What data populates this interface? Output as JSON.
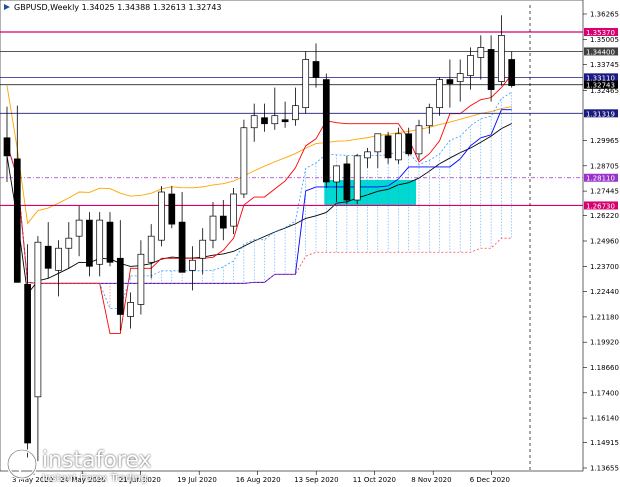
{
  "chart_title": "GBPUSD,Weekly  1.34025 1.34388 1.32613 1.32743",
  "chart_data": {
    "type": "candlestick",
    "title": "GBPUSD,Weekly  1.34025 1.34388 1.32613 1.32743",
    "symbol": "GBPUSD",
    "timeframe": "Weekly",
    "ohlc_readout": {
      "open": 1.34025,
      "high": 1.34388,
      "low": 1.32613,
      "close": 1.32743
    },
    "ylim": [
      1.3655,
      1.3626
    ],
    "y_ticks": [
      "1.36265",
      "1.35005",
      "1.33745",
      "1.32465",
      "1.29965",
      "1.28705",
      "1.27445",
      "1.26220",
      "1.24960",
      "1.23700",
      "1.22440",
      "1.21180",
      "1.19920",
      "1.18660",
      "1.17400",
      "1.16140",
      "1.14915",
      "1.13655"
    ],
    "x_ticks": [
      "3 May 2020",
      "24 May 2020",
      "21 Jun 2020",
      "19 Jul 2020",
      "16 Aug 2020",
      "13 Sep 2020",
      "11 Oct 2020",
      "8 Nov 2020",
      "6 Dec 2020"
    ],
    "candles": [
      {
        "o": 1.301,
        "h": 1.3165,
        "l": 1.279,
        "c": 1.292
      },
      {
        "o": 1.2905,
        "h": 1.317,
        "l": 1.246,
        "c": 1.229
      },
      {
        "o": 1.228,
        "h": 1.248,
        "l": 1.141,
        "c": 1.149
      },
      {
        "o": 1.172,
        "h": 1.252,
        "l": 1.14,
        "c": 1.249
      },
      {
        "o": 1.247,
        "h": 1.259,
        "l": 1.231,
        "c": 1.236
      },
      {
        "o": 1.235,
        "h": 1.25,
        "l": 1.222,
        "c": 1.246
      },
      {
        "o": 1.246,
        "h": 1.259,
        "l": 1.236,
        "c": 1.251
      },
      {
        "o": 1.252,
        "h": 1.267,
        "l": 1.242,
        "c": 1.26
      },
      {
        "o": 1.26,
        "h": 1.264,
        "l": 1.232,
        "c": 1.237
      },
      {
        "o": 1.238,
        "h": 1.264,
        "l": 1.232,
        "c": 1.26
      },
      {
        "o": 1.259,
        "h": 1.264,
        "l": 1.237,
        "c": 1.239
      },
      {
        "o": 1.241,
        "h": 1.26,
        "l": 1.205,
        "c": 1.213
      },
      {
        "o": 1.212,
        "h": 1.224,
        "l": 1.206,
        "c": 1.219
      },
      {
        "o": 1.218,
        "h": 1.25,
        "l": 1.213,
        "c": 1.243
      },
      {
        "o": 1.239,
        "h": 1.258,
        "l": 1.231,
        "c": 1.252
      },
      {
        "o": 1.25,
        "h": 1.277,
        "l": 1.247,
        "c": 1.274
      },
      {
        "o": 1.273,
        "h": 1.277,
        "l": 1.256,
        "c": 1.258
      },
      {
        "o": 1.259,
        "h": 1.274,
        "l": 1.234,
        "c": 1.234
      },
      {
        "o": 1.235,
        "h": 1.247,
        "l": 1.225,
        "c": 1.24
      },
      {
        "o": 1.241,
        "h": 1.256,
        "l": 1.233,
        "c": 1.25
      },
      {
        "o": 1.25,
        "h": 1.269,
        "l": 1.246,
        "c": 1.262
      },
      {
        "o": 1.262,
        "h": 1.27,
        "l": 1.25,
        "c": 1.256
      },
      {
        "o": 1.257,
        "h": 1.276,
        "l": 1.253,
        "c": 1.273
      },
      {
        "o": 1.273,
        "h": 1.31,
        "l": 1.271,
        "c": 1.306
      },
      {
        "o": 1.306,
        "h": 1.318,
        "l": 1.299,
        "c": 1.312
      },
      {
        "o": 1.311,
        "h": 1.318,
        "l": 1.304,
        "c": 1.308
      },
      {
        "o": 1.308,
        "h": 1.326,
        "l": 1.305,
        "c": 1.312
      },
      {
        "o": 1.31,
        "h": 1.319,
        "l": 1.306,
        "c": 1.309
      },
      {
        "o": 1.31,
        "h": 1.326,
        "l": 1.307,
        "c": 1.317
      },
      {
        "o": 1.316,
        "h": 1.344,
        "l": 1.313,
        "c": 1.34
      },
      {
        "o": 1.339,
        "h": 1.348,
        "l": 1.326,
        "c": 1.331
      },
      {
        "o": 1.33,
        "h": 1.333,
        "l": 1.276,
        "c": 1.279
      },
      {
        "o": 1.279,
        "h": 1.287,
        "l": 1.269,
        "c": 1.287
      },
      {
        "o": 1.288,
        "h": 1.292,
        "l": 1.268,
        "c": 1.27
      },
      {
        "o": 1.27,
        "h": 1.293,
        "l": 1.268,
        "c": 1.292
      },
      {
        "o": 1.291,
        "h": 1.296,
        "l": 1.286,
        "c": 1.294
      },
      {
        "o": 1.294,
        "h": 1.303,
        "l": 1.286,
        "c": 1.303
      },
      {
        "o": 1.302,
        "h": 1.304,
        "l": 1.288,
        "c": 1.291
      },
      {
        "o": 1.29,
        "h": 1.306,
        "l": 1.288,
        "c": 1.303
      },
      {
        "o": 1.303,
        "h": 1.306,
        "l": 1.292,
        "c": 1.293
      },
      {
        "o": 1.293,
        "h": 1.31,
        "l": 1.29,
        "c": 1.307
      },
      {
        "o": 1.307,
        "h": 1.318,
        "l": 1.303,
        "c": 1.316
      },
      {
        "o": 1.316,
        "h": 1.331,
        "l": 1.312,
        "c": 1.33
      },
      {
        "o": 1.33,
        "h": 1.34,
        "l": 1.316,
        "c": 1.328
      },
      {
        "o": 1.329,
        "h": 1.34,
        "l": 1.319,
        "c": 1.333
      },
      {
        "o": 1.332,
        "h": 1.346,
        "l": 1.325,
        "c": 1.342
      },
      {
        "o": 1.341,
        "h": 1.352,
        "l": 1.33,
        "c": 1.346
      },
      {
        "o": 1.345,
        "h": 1.352,
        "l": 1.319,
        "c": 1.325
      },
      {
        "o": 1.329,
        "h": 1.362,
        "l": 1.327,
        "c": 1.352
      },
      {
        "o": 1.34,
        "h": 1.344,
        "l": 1.326,
        "c": 1.327
      }
    ],
    "horizontal_levels": [
      {
        "price": 1.3537,
        "label": "1.35370",
        "color": "#d6006e"
      },
      {
        "price": 1.344,
        "label": "1.34400",
        "color": "#404040"
      },
      {
        "price": 1.3311,
        "label": "1.33110",
        "color": "#1a1a80"
      },
      {
        "price": 1.32743,
        "label": "1.32743",
        "color": "#000000"
      },
      {
        "price": 1.31319,
        "label": "1.31319",
        "color": "#1a1a80"
      },
      {
        "price": 1.2811,
        "label": "1.28110",
        "color": "#9933cc"
      },
      {
        "price": 1.2673,
        "label": "1.26730",
        "color": "#d6006e"
      }
    ],
    "highlight_zone": {
      "from_week": 31,
      "to_week": 40,
      "price_top": 1.28,
      "price_bottom": 1.2673,
      "color": "#00d8d0"
    },
    "colors": {
      "bull": "#ffffff",
      "bear": "#000000",
      "tenkan": "#ff0000",
      "kijun": "#0000ff",
      "ma_long": "#ffa500",
      "ma_black": "#000000",
      "kumo": "#3399ff",
      "chikou_red": "#ff4444"
    }
  },
  "watermark": {
    "brand": "instaforex",
    "tagline": "Instant Forex Trading"
  }
}
